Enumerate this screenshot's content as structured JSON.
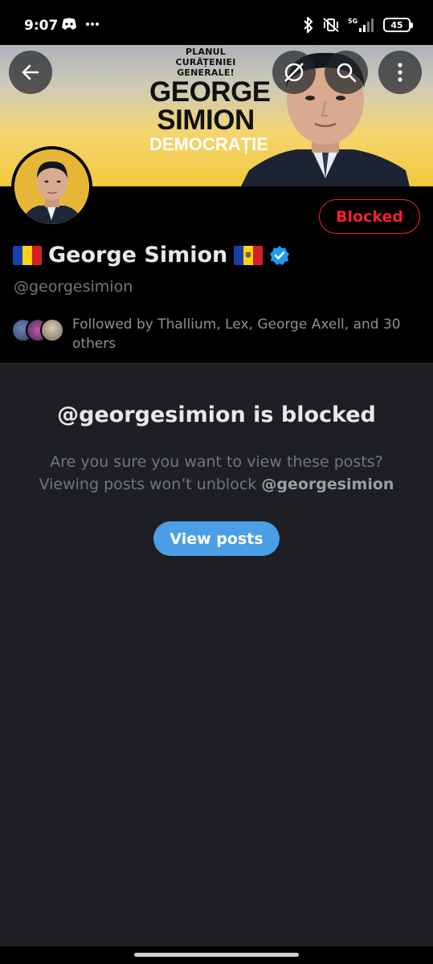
{
  "status_bar": {
    "time": "9:07",
    "left_icons": [
      "discord-icon",
      "more-dots-icon"
    ],
    "right_icons": [
      "bluetooth-icon",
      "vibrate-off-icon",
      "signal-5g-icon"
    ],
    "network_label": "5G",
    "battery": "45"
  },
  "banner": {
    "kicker_line1": "PLANUL",
    "kicker_line2": "CURĂȚENIEI GENERALE!",
    "name_line1": "GEORGE",
    "name_line2": "SIMION",
    "tagline": "DEMOCRAȚIE",
    "colors": {
      "yellow": "#f2c93c",
      "sky": "#aeb2bb"
    }
  },
  "toolbar": {
    "back_icon": "arrow-left-icon",
    "grok_icon": "grok-icon",
    "search_icon": "search-icon",
    "more_icon": "more-vertical-icon"
  },
  "profile": {
    "display_name": "George Simion",
    "handle": "@georgesimion",
    "blocked_label": "Blocked",
    "verified": true,
    "flags": [
      "romania-flag",
      "moldova-flag"
    ],
    "followed_by": "Followed by Thallium, Lex, George Axell, and 30 others"
  },
  "blocked_notice": {
    "title": "@georgesimion is blocked",
    "desc_line1": "Are you sure you want to view these posts?",
    "desc_line2_prefix": "Viewing posts won’t unblock ",
    "desc_line2_handle": "@georgesimion",
    "button_label": "View posts"
  },
  "colors": {
    "accent": "#4a9fe6",
    "blocked_red": "#f4212e",
    "verified_blue": "#1d9bf0"
  }
}
